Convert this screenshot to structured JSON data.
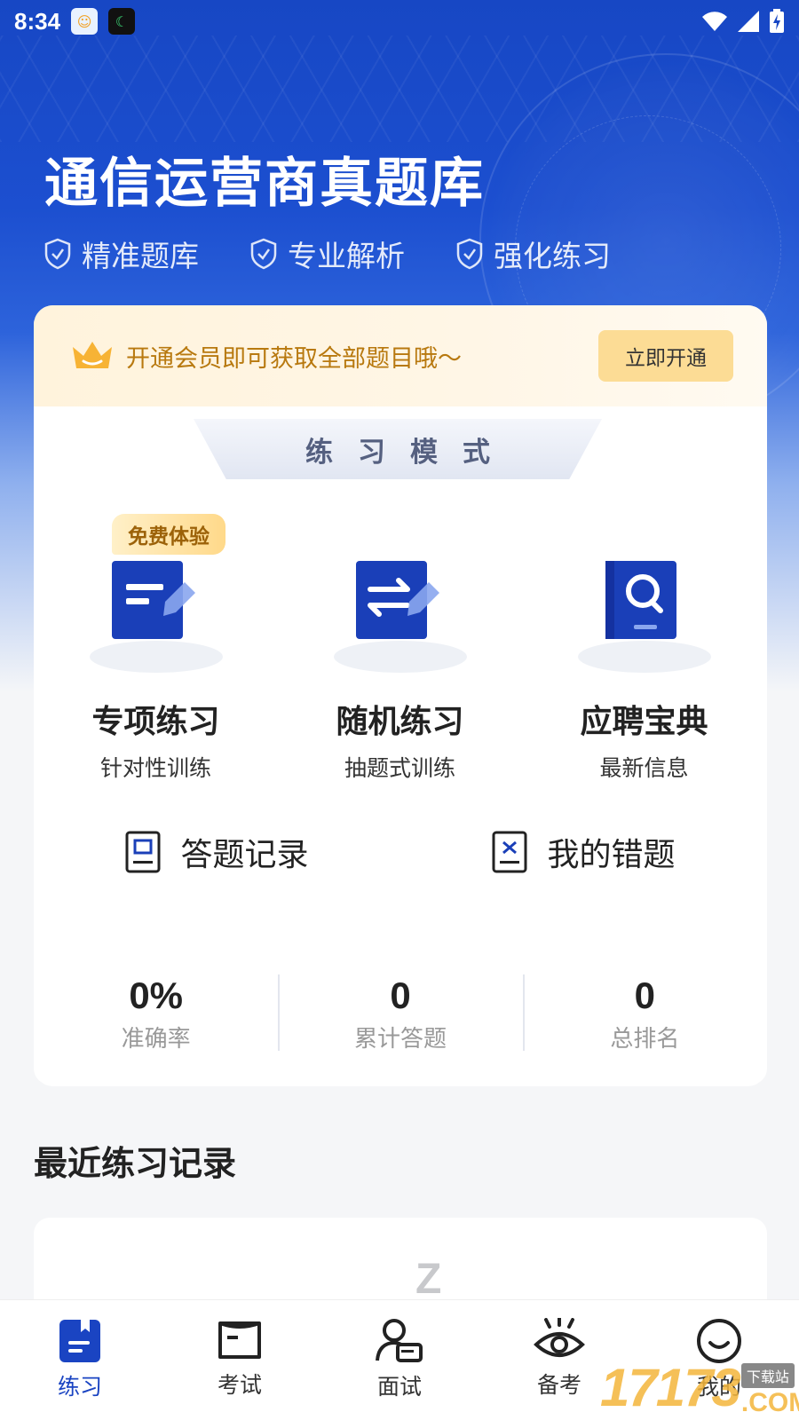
{
  "status_bar": {
    "time": "8:34",
    "icons": [
      "app-avatar-icon",
      "sleep-app-icon",
      "wifi-icon",
      "signal-icon",
      "battery-charging-icon"
    ]
  },
  "hero": {
    "title": "通信运营商真题库",
    "features": [
      "精准题库",
      "专业解析",
      "强化练习"
    ]
  },
  "vip": {
    "text": "开通会员即可获取全部题目哦～",
    "button": "立即开通"
  },
  "practice": {
    "banner": "练习模式",
    "modes": [
      {
        "title": "专项练习",
        "subtitle": "针对性训练",
        "badge": "免费体验",
        "icon": "edit-document-icon"
      },
      {
        "title": "随机练习",
        "subtitle": "抽题式训练",
        "icon": "shuffle-document-icon"
      },
      {
        "title": "应聘宝典",
        "subtitle": "最新信息",
        "icon": "search-book-icon"
      }
    ],
    "records": [
      {
        "label": "答题记录",
        "icon": "answer-record-icon"
      },
      {
        "label": "我的错题",
        "icon": "wrong-questions-icon"
      }
    ]
  },
  "stats": [
    {
      "value": "0%",
      "label": "准确率"
    },
    {
      "value": "0",
      "label": "累计答题"
    },
    {
      "value": "0",
      "label": "总排名"
    }
  ],
  "recent": {
    "title": "最近练习记录",
    "empty_icon": "Z"
  },
  "tabs": [
    {
      "label": "练习",
      "icon": "practice-book-icon",
      "active": true
    },
    {
      "label": "考试",
      "icon": "exam-book-icon",
      "active": false
    },
    {
      "label": "面试",
      "icon": "interview-person-icon",
      "active": false
    },
    {
      "label": "备考",
      "icon": "eye-icon",
      "active": false
    },
    {
      "label": "我的",
      "icon": "smile-face-icon",
      "active": false
    }
  ],
  "watermark": {
    "number": "17173",
    "site": "下载站",
    "suffix": ".COM"
  },
  "colors": {
    "brand_blue": "#1a44c2",
    "vip_gold": "#b8790f",
    "vip_button": "#fcdc95"
  }
}
